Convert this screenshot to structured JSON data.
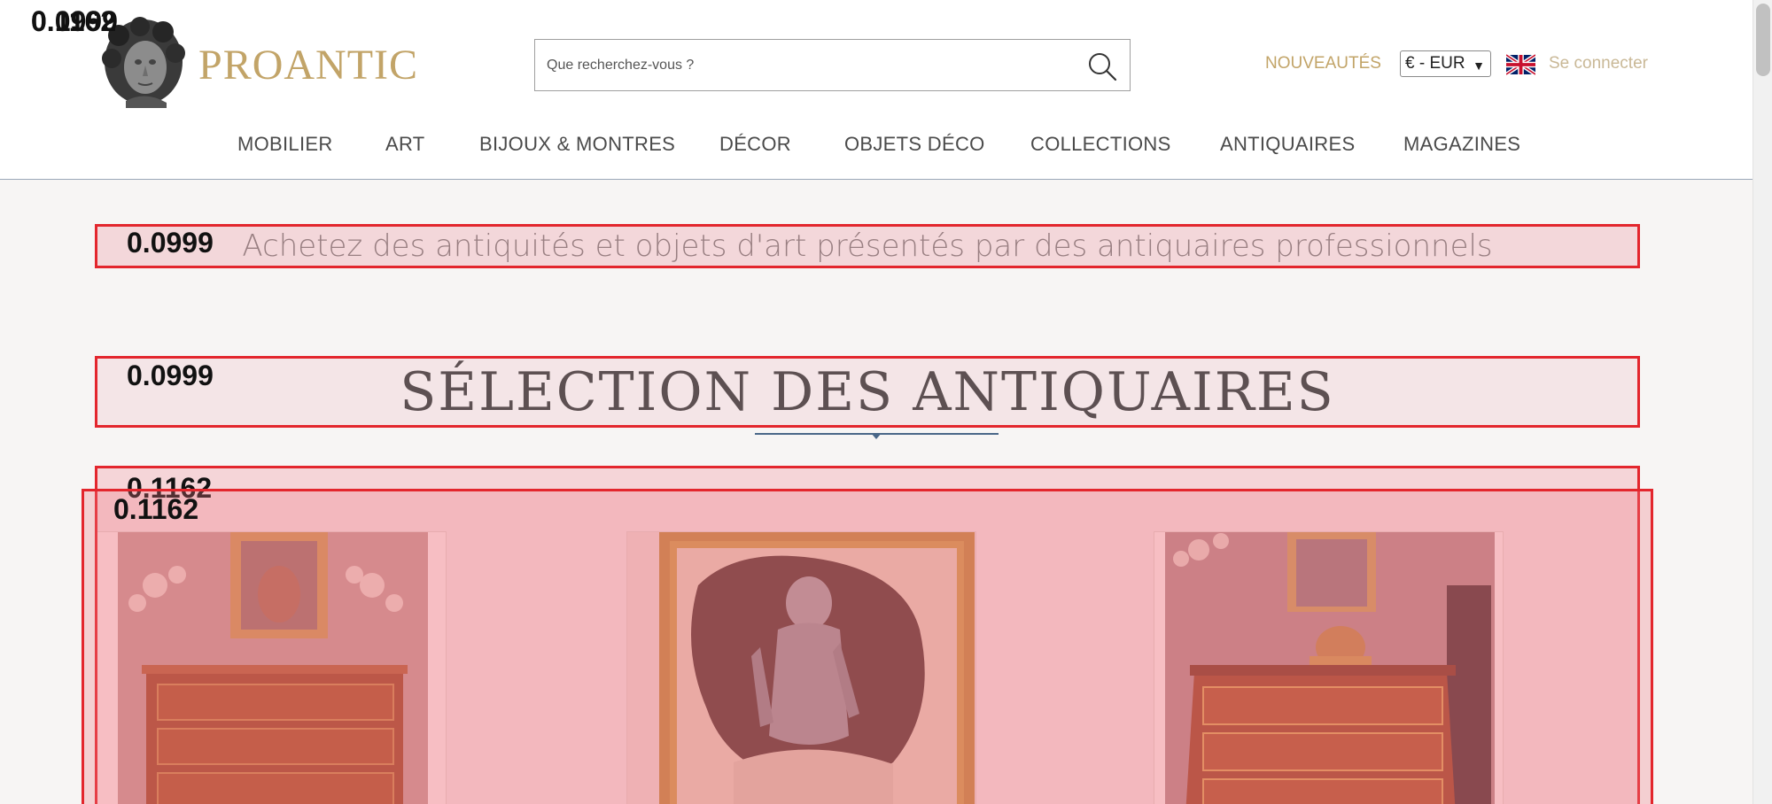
{
  "header": {
    "logo_text": "PROANTIC",
    "search_placeholder": "Que recherchez-vous ?",
    "nouveautes_label": "NOUVEAUTÉS",
    "currency_value": "€ - EUR",
    "login_label": "Se connecter",
    "brand_color": "#c2a468"
  },
  "nav": {
    "items": [
      {
        "label": "MOBILIER"
      },
      {
        "label": "ART"
      },
      {
        "label": "BIJOUX & MONTRES"
      },
      {
        "label": "DÉCOR"
      },
      {
        "label": "OBJETS DÉCO"
      },
      {
        "label": "COLLECTIONS"
      },
      {
        "label": "ANTIQUAIRES"
      },
      {
        "label": "MAGAZINES"
      }
    ]
  },
  "main": {
    "tagline": "Achetez des antiquités et objets d'art présentés par des antiquaires professionnels",
    "section_title": "SÉLECTION DES ANTIQUAIRES",
    "cards": [
      {
        "image": "commode-with-candelabras"
      },
      {
        "image": "painting-knight-in-armor"
      },
      {
        "image": "marquetry-commode-with-cherub"
      }
    ]
  },
  "overlay_labels": {
    "corner_a": "0.1162",
    "corner_b": "0.0999",
    "tagline": "0.0999",
    "title": "0.0999",
    "cards_a": "0.1162",
    "cards_b": "0.1162"
  },
  "overlay_color": "#e3262d"
}
